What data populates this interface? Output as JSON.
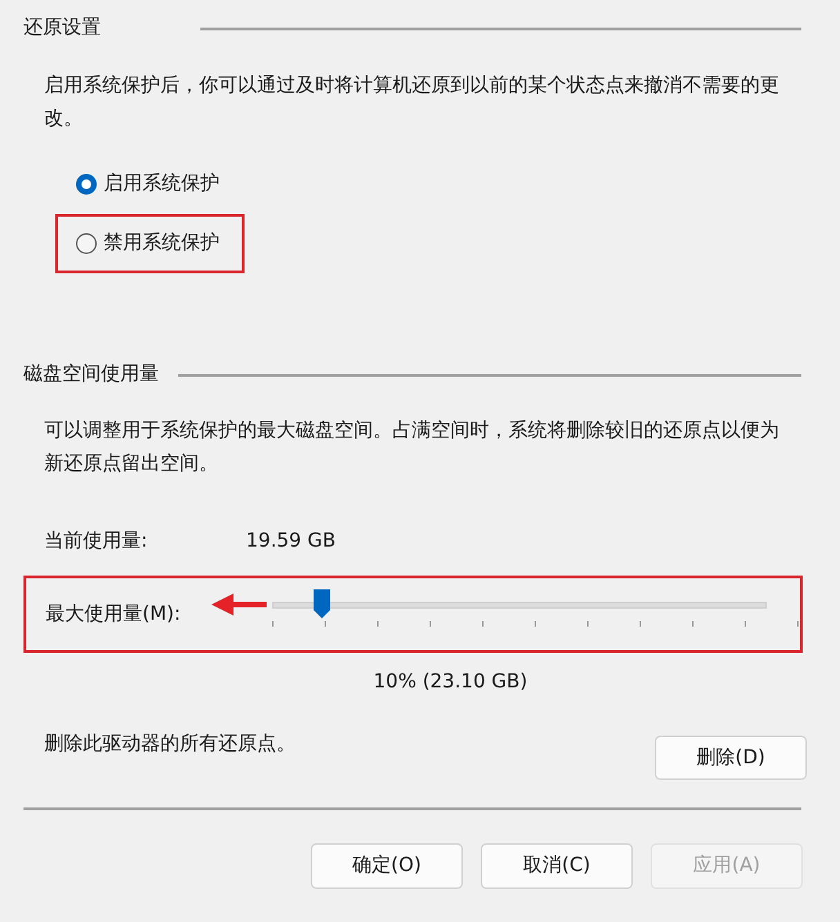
{
  "restore_settings": {
    "title": "还原设置",
    "description": "启用系统保护后，你可以通过及时将计算机还原到以前的某个状态点来撤消不需要的更改。",
    "options": [
      {
        "label": "启用系统保护",
        "selected": true,
        "highlighted": false
      },
      {
        "label": "禁用系统保护",
        "selected": false,
        "highlighted": true
      }
    ]
  },
  "disk_usage": {
    "title": "磁盘空间使用量",
    "description": "可以调整用于系统保护的最大磁盘空间。占满空间时，系统将删除较旧的还原点以便为新还原点留出空间。",
    "current_label": "当前使用量:",
    "current_value": "19.59 GB",
    "slider": {
      "label": "最大使用量(M):",
      "level": 0.1,
      "highlighted": true,
      "reading": "10% (23.10 GB)"
    },
    "delete_text": "删除此驱动器的所有还原点。",
    "delete_button": "删除(D)"
  },
  "buttons": [
    {
      "label": "确定(O)",
      "disabled": false
    },
    {
      "label": "取消(C)",
      "disabled": false
    },
    {
      "label": "应用(A)",
      "disabled": true
    }
  ]
}
